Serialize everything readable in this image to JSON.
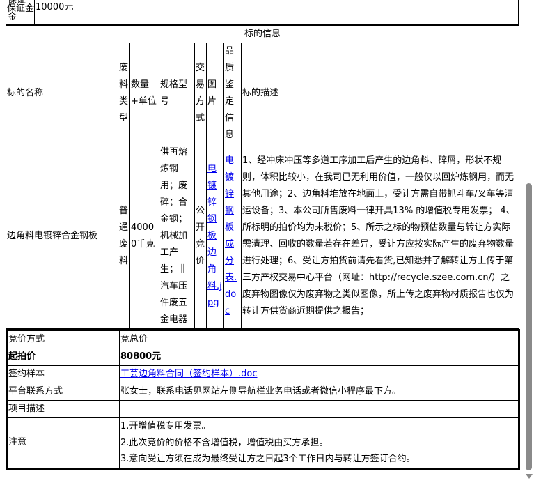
{
  "deposit": {
    "label": "保证金",
    "value": "10000元"
  },
  "section_title": "标的信息",
  "headers": [
    "标的名称",
    "废料类型",
    "数量+单位",
    "规格型号",
    "交易方式",
    "图片",
    "品质鉴定信息",
    "标的描述"
  ],
  "item": {
    "name": "边角料电镀锌合金钢板",
    "waste_type": "普通废料",
    "quantity": "40000千克",
    "spec": "供再熔炼钢用；废碎；合金钢；机械加工产生；非汽车压件废五金电器",
    "trade_method": "公开竞价",
    "image_link": "电镀锌钢板边角料.jpg",
    "quality_link": "电镀锌钢板成分表.doc",
    "description": "1、经冲床冲压等多道工序加工后产生的边角料、碎屑，形状不规则，体积比较小，在我司已无利用价值，一般仅以回炉炼钢用，而无其他用途；2、边角料堆放在地面上，受让方需自带抓斗车/叉车等清运设备；3、本公司所售废料一律开具13% 的增值税专用发票； 4、所标明的拍价均为未税价；5、所示之标的物预估数量与转让方实际需清理、回收的数量若存在差异，受让方应按实际产生的废弃物数量进行处理；6、受让方拍货前请先看货,已知悉并了解转让方上传于第三方产权交易中心平台（网址：http://recycle.szee.com.cn/）之废弃物图像仅为废弃物之类似图像，所上传之废弃物材质报告也仅为转让方供货商近期提供之报告；"
  },
  "details": {
    "bid_method": {
      "label": "竞价方式",
      "value": "竞总价"
    },
    "start_price": {
      "label": "起拍价",
      "value": "80800元"
    },
    "contract": {
      "label": "签约样本",
      "value": "工芸边角料合同（签约样本）.doc"
    },
    "contact": {
      "label": "平台联系方式",
      "value": "张女士，联系电话见网站左侧导航栏业务电话或者微信小程序最下方。"
    },
    "project": {
      "label": "项目描述",
      "value": ""
    },
    "notes": {
      "label": "注意",
      "items": [
        "1.开增值税专用发票。",
        "2.此次竞价的价格不含增值税，增值税由买方承担。",
        "3.意向受让方须在成为最终受让方之日起3个工作日内与转让方签订合约。"
      ]
    }
  },
  "colors": {
    "link": "#0000ee",
    "border": "#000000"
  }
}
